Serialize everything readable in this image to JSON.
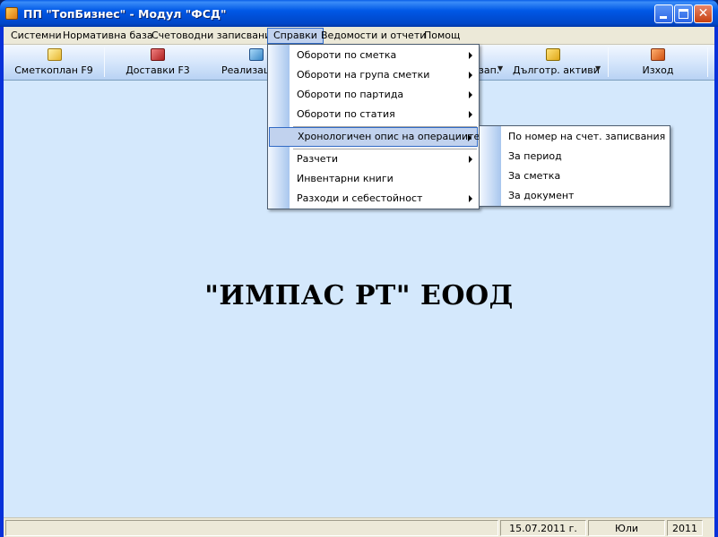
{
  "window": {
    "title": "ПП \"ТопБизнес\" - Модул \"ФСД\"",
    "close_glyph": "✕"
  },
  "menubar": {
    "items": [
      "Системни",
      "Нормативна база",
      "Счетоводни записвания",
      "Справки",
      "Ведомости и отчети",
      "Помощ"
    ]
  },
  "toolbar": {
    "buttons": [
      {
        "label": "Сметкоплан F9",
        "icon": "folder-document-icon"
      },
      {
        "label": "Доставки F3",
        "icon": "truck-icon"
      },
      {
        "label": "Реализаци",
        "icon": "sales-icon"
      },
      {
        "label": "зап.",
        "icon": "records-icon"
      },
      {
        "label": "Дълготр. активи",
        "icon": "folder-icon"
      },
      {
        "label": "Изход",
        "icon": "exit-icon"
      }
    ]
  },
  "main": {
    "company_name": "\"ИМПАС РТ\" ЕООД"
  },
  "menu_spravki": {
    "items": [
      {
        "label": "Обороти по сметка",
        "has_submenu": true
      },
      {
        "label": "Обороти на група сметки",
        "has_submenu": true
      },
      {
        "label": "Обороти по партида",
        "has_submenu": true
      },
      {
        "label": "Обороти по статия",
        "has_submenu": true
      },
      {
        "label": "Хронологичен опис на операциите",
        "has_submenu": true
      },
      {
        "label": "Разчети",
        "has_submenu": true
      },
      {
        "label": "Инвентарни книги",
        "has_submenu": false
      },
      {
        "label": "Разходи и себестойност",
        "has_submenu": true
      }
    ]
  },
  "submenu_chrono": {
    "items": [
      "По номер на счет. записвания",
      "За период",
      "За сметка",
      "За документ"
    ]
  },
  "statusbar": {
    "date": "15.07.2011 г.",
    "month": "Юли",
    "year": "2011"
  },
  "colors": {
    "titlebar": "#0058e6",
    "client_bg": "#d4e8fc",
    "menu_highlight": "#c1d2ee",
    "highlight_border": "#316ac5"
  }
}
